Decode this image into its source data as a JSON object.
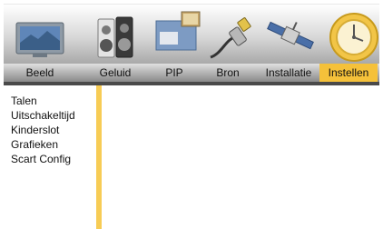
{
  "tabs": [
    {
      "label": "Beeld",
      "icon": "tv-icon",
      "active": false
    },
    {
      "label": "Geluid",
      "icon": "speaker-icon",
      "active": false
    },
    {
      "label": "PIP",
      "icon": "pip-icon",
      "active": false
    },
    {
      "label": "Bron",
      "icon": "cable-plug-icon",
      "active": false
    },
    {
      "label": "Installatie",
      "icon": "satellite-icon",
      "active": false
    },
    {
      "label": "Instellen",
      "icon": "clock-gear-icon",
      "active": true
    }
  ],
  "menu_items": [
    "Talen",
    "Uitschakeltijd",
    "Kinderslot",
    "Grafieken",
    "Scart Config"
  ],
  "colors": {
    "accent": "#f5c13a",
    "accent_bar": "#f7cc55",
    "tab_bar": "#b8b8b8",
    "divider": "#4a4a4a"
  }
}
